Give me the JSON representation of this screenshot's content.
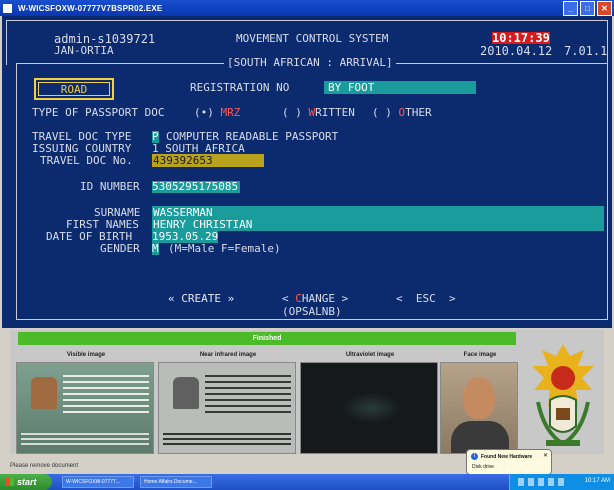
{
  "window": {
    "title": "W-WICSFOXW-07777V7BSPR02.EXE"
  },
  "header": {
    "user": "admin-s1039721",
    "location": "JAN-ORTIA",
    "system_title": "MOVEMENT CONTROL SYSTEM",
    "time": "10:17:39",
    "date": "2010.04.12",
    "version": "7.01.1",
    "subtitle": "[SOUTH AFRICAN : ARRIVAL]"
  },
  "form": {
    "road_label": "ROAD",
    "registration_label": "REGISTRATION NO",
    "registration_value": "BY FOOT",
    "passport_type_label": "TYPE OF PASSPORT DOC",
    "passport_options": [
      {
        "mark": "(•)",
        "pre": "",
        "hot": "M",
        "post": "RZ"
      },
      {
        "mark": "( )",
        "pre": "",
        "hot": "W",
        "post": "RITTEN"
      },
      {
        "mark": "( )",
        "pre": "",
        "hot": "O",
        "post": "THER"
      }
    ],
    "travel_doc_type_label": "TRAVEL DOC TYPE",
    "travel_doc_type_code": "P",
    "travel_doc_type_desc": "COMPUTER READABLE PASSPORT",
    "issuing_country_label": "ISSUING COUNTRY",
    "issuing_country_value": "1 SOUTH AFRICA",
    "travel_doc_no_label": "TRAVEL DOC No.",
    "travel_doc_no_value": "439392653",
    "id_number_label": "ID NUMBER",
    "id_number_value": "5305295175085",
    "surname_label": "SURNAME",
    "surname_value": "WASSERMAN",
    "first_names_label": "FIRST NAMES",
    "first_names_value": "HENRY CHRISTIAN",
    "dob_label": "DATE OF BIRTH",
    "dob_value": "1953.05.29",
    "gender_label": "GENDER",
    "gender_value": "M",
    "gender_hint": "(M=Male F=Female)"
  },
  "actions": {
    "create": "« CREATE »",
    "change_pre": "< ",
    "change_hot": "C",
    "change_post": "HANGE >",
    "esc": "<  ESC  >",
    "footer": "(OPSALNB)"
  },
  "scanner": {
    "status": "Finished",
    "captions": [
      "Visible image",
      "Near infrared image",
      "Ultraviolet image",
      "Face image"
    ]
  },
  "status_message": "Please remove document",
  "taskbar": {
    "start": "start",
    "buttons": [
      "W-WICSFOXW-07777...",
      "Home Affairs Docume..."
    ],
    "clock": "10:17 AM"
  },
  "notification": {
    "title": "Found New Hardware",
    "body": "Disk drive"
  },
  "colors": {
    "terminal_bg": "#0c2a6e",
    "field_cyan": "#1a9c9c",
    "field_yellow": "#b8a21e",
    "hotkey_red": "#ff5a5a",
    "time_red": "#d41c1c"
  }
}
